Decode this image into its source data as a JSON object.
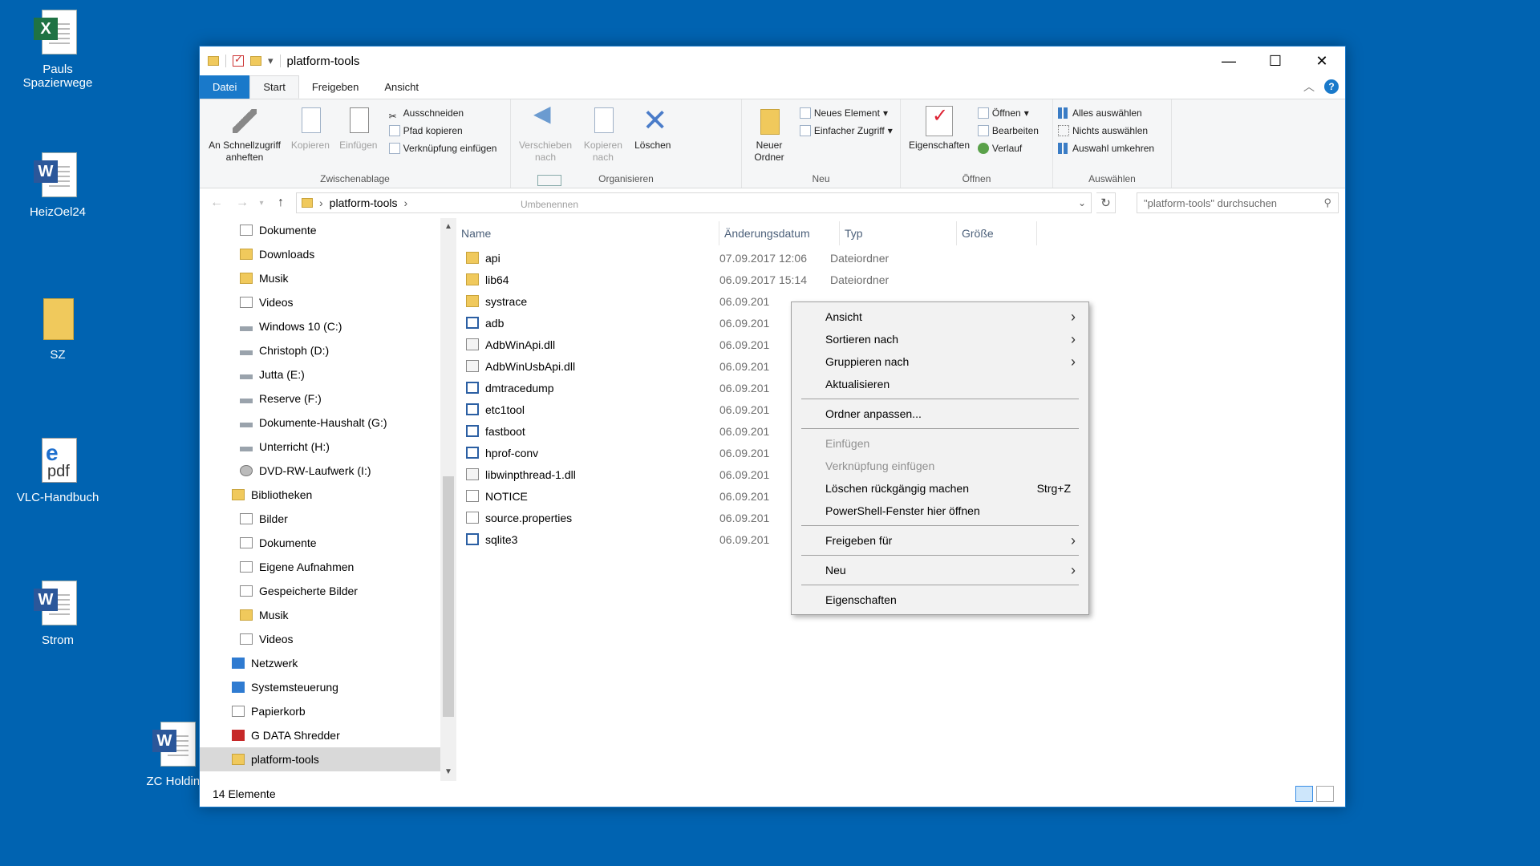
{
  "desktop_icons": [
    {
      "label": "Pauls Spazierwege",
      "type": "excel-icon"
    },
    {
      "label": "HeizOel24",
      "type": "word-icon"
    },
    {
      "label": "SZ",
      "type": "folder-pdf-icon"
    },
    {
      "label": "VLC-Handbuch",
      "type": "edge-pdf-icon"
    },
    {
      "label": "Strom",
      "type": "word-icon"
    },
    {
      "label": "ZC Holding",
      "type": "word-icon"
    }
  ],
  "window": {
    "title": "platform-tools",
    "controls": {
      "minimize": "—",
      "maximize": "☐",
      "close": "✕"
    }
  },
  "ribbon_tabs": [
    "Datei",
    "Start",
    "Freigeben",
    "Ansicht"
  ],
  "ribbon": {
    "clipboard": {
      "label": "Zwischenablage",
      "pin": "An Schnellzugriff anheften",
      "copy": "Kopieren",
      "paste": "Einfügen",
      "cut": "Ausschneiden",
      "copy_path": "Pfad kopieren",
      "paste_shortcut": "Verknüpfung einfügen"
    },
    "organize": {
      "label": "Organisieren",
      "move": "Verschieben nach",
      "copy_to": "Kopieren nach",
      "delete": "Löschen",
      "rename": "Umbenennen"
    },
    "new": {
      "label": "Neu",
      "new_folder": "Neuer Ordner",
      "new_item": "Neues Element",
      "easy_access": "Einfacher Zugriff"
    },
    "open": {
      "label": "Öffnen",
      "properties": "Eigenschaften",
      "open": "Öffnen",
      "edit": "Bearbeiten",
      "history": "Verlauf"
    },
    "select": {
      "label": "Auswählen",
      "select_all": "Alles auswählen",
      "select_none": "Nichts auswählen",
      "invert": "Auswahl umkehren"
    }
  },
  "address": {
    "path": "platform-tools",
    "search_placeholder": "\"platform-tools\" durchsuchen"
  },
  "nav_items": [
    {
      "label": "Dokumente",
      "icon": "documents-icon",
      "indent": 1
    },
    {
      "label": "Downloads",
      "icon": "downloads-icon",
      "indent": 1
    },
    {
      "label": "Musik",
      "icon": "music-icon",
      "indent": 1
    },
    {
      "label": "Videos",
      "icon": "videos-icon",
      "indent": 1
    },
    {
      "label": "Windows 10 (C:)",
      "icon": "drive-icon",
      "indent": 1
    },
    {
      "label": "Christoph (D:)",
      "icon": "drive-icon",
      "indent": 1
    },
    {
      "label": "Jutta (E:)",
      "icon": "drive-icon",
      "indent": 1
    },
    {
      "label": "Reserve (F:)",
      "icon": "drive-icon",
      "indent": 1
    },
    {
      "label": "Dokumente-Haushalt (G:)",
      "icon": "drive-icon",
      "indent": 1
    },
    {
      "label": "Unterricht (H:)",
      "icon": "drive-icon",
      "indent": 1
    },
    {
      "label": "DVD-RW-Laufwerk (I:)",
      "icon": "dvd-icon",
      "indent": 1
    },
    {
      "label": "Bibliotheken",
      "icon": "libraries-icon",
      "indent": 0
    },
    {
      "label": "Bilder",
      "icon": "pictures-icon",
      "indent": 1
    },
    {
      "label": "Dokumente",
      "icon": "documents-icon",
      "indent": 1
    },
    {
      "label": "Eigene Aufnahmen",
      "icon": "recordings-icon",
      "indent": 1
    },
    {
      "label": "Gespeicherte Bilder",
      "icon": "saved-pictures-icon",
      "indent": 1
    },
    {
      "label": "Musik",
      "icon": "music-icon",
      "indent": 1
    },
    {
      "label": "Videos",
      "icon": "videos-icon",
      "indent": 1
    },
    {
      "label": "Netzwerk",
      "icon": "network-icon",
      "indent": 0
    },
    {
      "label": "Systemsteuerung",
      "icon": "control-panel-icon",
      "indent": 0
    },
    {
      "label": "Papierkorb",
      "icon": "recycle-bin-icon",
      "indent": 0
    },
    {
      "label": "G DATA Shredder",
      "icon": "shredder-icon",
      "indent": 0
    },
    {
      "label": "platform-tools",
      "icon": "folder-icon",
      "indent": 0,
      "selected": true
    }
  ],
  "columns": {
    "name": "Name",
    "date": "Änderungsdatum",
    "type": "Typ",
    "size": "Größe"
  },
  "files": [
    {
      "name": "api",
      "date": "07.09.2017 12:06",
      "type": "Dateiordner",
      "icon": "folder"
    },
    {
      "name": "lib64",
      "date": "06.09.2017 15:14",
      "type": "Dateiordner",
      "icon": "folder"
    },
    {
      "name": "systrace",
      "date": "06.09.201",
      "type": "",
      "icon": "folder"
    },
    {
      "name": "adb",
      "date": "06.09.201",
      "type": "",
      "icon": "exe"
    },
    {
      "name": "AdbWinApi.dll",
      "date": "06.09.201",
      "type": "",
      "icon": "dll"
    },
    {
      "name": "AdbWinUsbApi.dll",
      "date": "06.09.201",
      "type": "",
      "icon": "dll"
    },
    {
      "name": "dmtracedump",
      "date": "06.09.201",
      "type": "",
      "icon": "exe"
    },
    {
      "name": "etc1tool",
      "date": "06.09.201",
      "type": "",
      "icon": "exe"
    },
    {
      "name": "fastboot",
      "date": "06.09.201",
      "type": "",
      "icon": "exe"
    },
    {
      "name": "hprof-conv",
      "date": "06.09.201",
      "type": "",
      "icon": "exe"
    },
    {
      "name": "libwinpthread-1.dll",
      "date": "06.09.201",
      "type": "",
      "icon": "dll"
    },
    {
      "name": "NOTICE",
      "date": "06.09.201",
      "type": "",
      "icon": "file"
    },
    {
      "name": "source.properties",
      "date": "06.09.201",
      "type": "",
      "icon": "file"
    },
    {
      "name": "sqlite3",
      "date": "06.09.201",
      "type": "",
      "icon": "exe"
    }
  ],
  "status": {
    "count": "14 Elemente"
  },
  "context_menu": [
    {
      "label": "Ansicht",
      "submenu": true
    },
    {
      "label": "Sortieren nach",
      "submenu": true
    },
    {
      "label": "Gruppieren nach",
      "submenu": true
    },
    {
      "label": "Aktualisieren"
    },
    {
      "separator": true
    },
    {
      "label": "Ordner anpassen..."
    },
    {
      "separator": true
    },
    {
      "label": "Einfügen",
      "disabled": true
    },
    {
      "label": "Verknüpfung einfügen",
      "disabled": true
    },
    {
      "label": "Löschen rückgängig machen",
      "shortcut": "Strg+Z"
    },
    {
      "label": "PowerShell-Fenster hier öffnen"
    },
    {
      "separator": true
    },
    {
      "label": "Freigeben für",
      "submenu": true
    },
    {
      "separator": true
    },
    {
      "label": "Neu",
      "submenu": true
    },
    {
      "separator": true
    },
    {
      "label": "Eigenschaften"
    }
  ]
}
